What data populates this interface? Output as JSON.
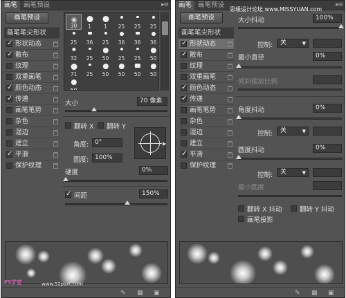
{
  "left": {
    "tabs": [
      "画笔",
      "画笔预设"
    ],
    "tabmenu": "▸≡",
    "preset_button": "画笔预设",
    "items": [
      {
        "label": "画笔笔尖形状",
        "checked": null,
        "lock": false,
        "head": true
      },
      {
        "label": "形状动态",
        "checked": true,
        "lock": true
      },
      {
        "label": "散布",
        "checked": true,
        "lock": true
      },
      {
        "label": "纹理",
        "checked": false,
        "lock": true
      },
      {
        "label": "双重画笔",
        "checked": false,
        "lock": true
      },
      {
        "label": "颜色动态",
        "checked": true,
        "lock": true
      },
      {
        "label": "传递",
        "checked": true,
        "lock": true
      },
      {
        "label": "画笔笔势",
        "checked": false,
        "lock": true
      },
      {
        "label": "杂色",
        "checked": false,
        "lock": true
      },
      {
        "label": "湿边",
        "checked": false,
        "lock": true
      },
      {
        "label": "建立",
        "checked": false,
        "lock": true
      },
      {
        "label": "平滑",
        "checked": true,
        "lock": true
      },
      {
        "label": "保护纹理",
        "checked": false,
        "lock": true
      }
    ],
    "brush_sizes": [
      "30",
      "1",
      "1",
      "25",
      "25",
      "25",
      "25",
      "36",
      "25",
      "36",
      "36",
      "36",
      "32",
      "25",
      "50",
      "25",
      "25",
      "50",
      "71",
      "25",
      "50",
      "50",
      "50",
      "50",
      "50"
    ],
    "size_label": "大小",
    "size_value": "70 像素",
    "size_level_pct": 28,
    "flip_x": "翻转 X",
    "flip_y": "翻转 Y",
    "angle_label": "角度:",
    "angle_value": "0°",
    "roundness_label": "圆度:",
    "roundness_value": "100%",
    "hardness_label": "硬度",
    "hardness_value": "0%",
    "hardness_level_pct": 0,
    "spacing_label": "间距",
    "spacing_value": "150%",
    "spacing_checked": true,
    "spacing_level_pct": 60,
    "watermark_left": "PS学堂",
    "watermark_url": "www.52psxt.com"
  },
  "right": {
    "tabs": [
      "画笔",
      "画笔预设"
    ],
    "tabmenu": "▸≡",
    "watermark_top": "思缘设计论坛 www.MISSYUAN.com",
    "preset_button": "画笔预设",
    "items": [
      {
        "label": "画笔笔尖形状",
        "checked": null,
        "lock": false,
        "head": true
      },
      {
        "label": "形状动态",
        "checked": true,
        "lock": true,
        "sel": true
      },
      {
        "label": "散布",
        "checked": true,
        "lock": true
      },
      {
        "label": "纹理",
        "checked": false,
        "lock": true
      },
      {
        "label": "双重画笔",
        "checked": false,
        "lock": true
      },
      {
        "label": "颜色动态",
        "checked": true,
        "lock": true
      },
      {
        "label": "传递",
        "checked": true,
        "lock": true
      },
      {
        "label": "画笔笔势",
        "checked": false,
        "lock": true
      },
      {
        "label": "杂色",
        "checked": false,
        "lock": true
      },
      {
        "label": "湿边",
        "checked": false,
        "lock": true
      },
      {
        "label": "建立",
        "checked": false,
        "lock": true
      },
      {
        "label": "平滑",
        "checked": true,
        "lock": true
      },
      {
        "label": "保护纹理",
        "checked": false,
        "lock": true
      }
    ],
    "size_jitter_label": "大小抖动",
    "size_jitter_value": "100%",
    "control1_label": "控制:",
    "control1_value": "关",
    "min_diameter_label": "最小直径",
    "min_diameter_value": "0%",
    "tilt_scale_label": "倾斜缩放比例",
    "angle_jitter_label": "角度抖动",
    "angle_jitter_value": "0%",
    "control2_label": "控制:",
    "control2_value": "关",
    "roundness_jitter_label": "圆度抖动",
    "roundness_jitter_value": "0%",
    "control3_label": "控制:",
    "control3_value": "关",
    "min_roundness_label": "最小圆度",
    "flip_x_jitter": "翻转 X 抖动",
    "flip_y_jitter": "翻转 Y 抖动",
    "brush_projection": "画笔投影"
  },
  "colors": {
    "panel": "#535353",
    "field": "#3c3c3c",
    "text": "#d8d8d8"
  }
}
